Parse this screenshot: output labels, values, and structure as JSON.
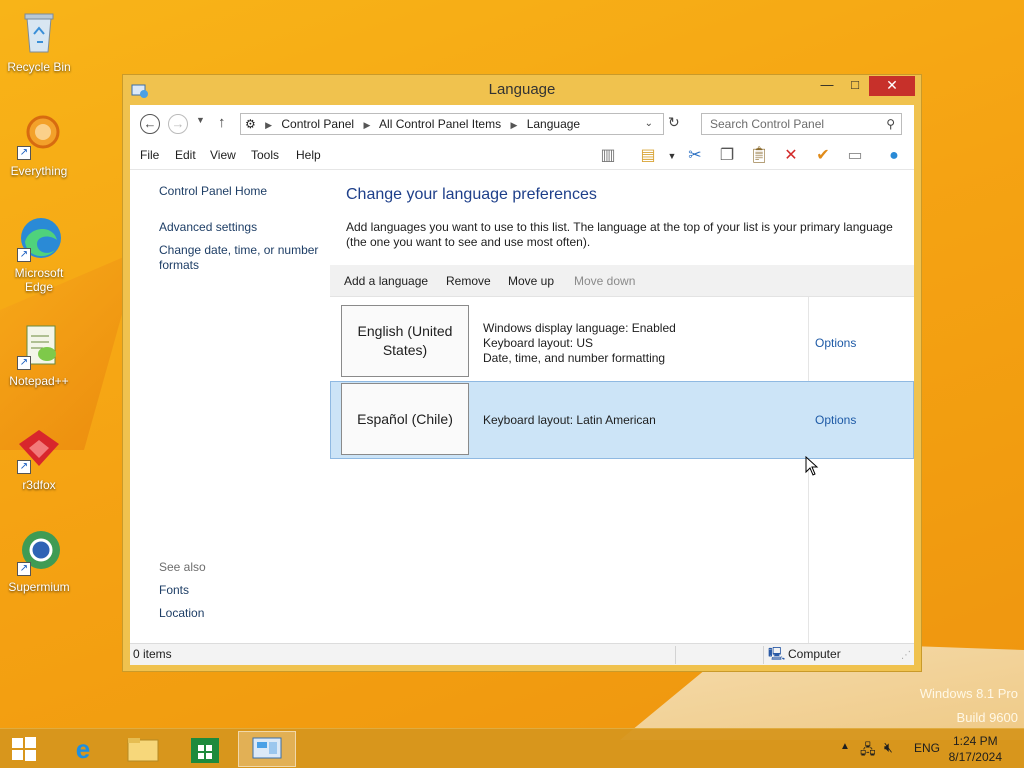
{
  "desktop": {
    "icons": [
      {
        "label": "Recycle Bin"
      },
      {
        "label": "Everything"
      },
      {
        "label": "Microsoft Edge"
      },
      {
        "label": "Notepad++"
      },
      {
        "label": "r3dfox"
      },
      {
        "label": "Supermium"
      }
    ],
    "watermark_line1": "Windows 8.1 Pro",
    "watermark_line2": "Build 9600"
  },
  "window": {
    "title": "Language",
    "minimize": "—",
    "maximize": "□",
    "close": "✕",
    "breadcrumb": [
      "Control Panel",
      "All Control Panel Items",
      "Language"
    ],
    "search_placeholder": "Search Control Panel",
    "menu": [
      "File",
      "Edit",
      "View",
      "Tools",
      "Help"
    ],
    "left_pane": {
      "home": "Control Panel Home",
      "advanced": "Advanced settings",
      "date_time": "Change date, time, or number formats",
      "see_also": "See also",
      "fonts": "Fonts",
      "location": "Location"
    },
    "heading": "Change your language preferences",
    "description": "Add languages you want to use to this list. The language at the top of your list is your primary language (the one you want to see and use most often).",
    "actions": {
      "add": "Add a language",
      "remove": "Remove",
      "move_up": "Move up",
      "move_down": "Move down"
    },
    "languages": [
      {
        "name": "English (United States)",
        "info": [
          "Windows display language: Enabled",
          "Keyboard layout: US",
          "Date, time, and number formatting"
        ],
        "options": "Options"
      },
      {
        "name": "Español (Chile)",
        "info": [
          "Keyboard layout: Latin American"
        ],
        "options": "Options"
      }
    ],
    "status_items": "0 items",
    "status_computer": "Computer"
  },
  "taskbar": {
    "language": "ENG",
    "time": "1:24 PM",
    "date": "8/17/2024"
  }
}
